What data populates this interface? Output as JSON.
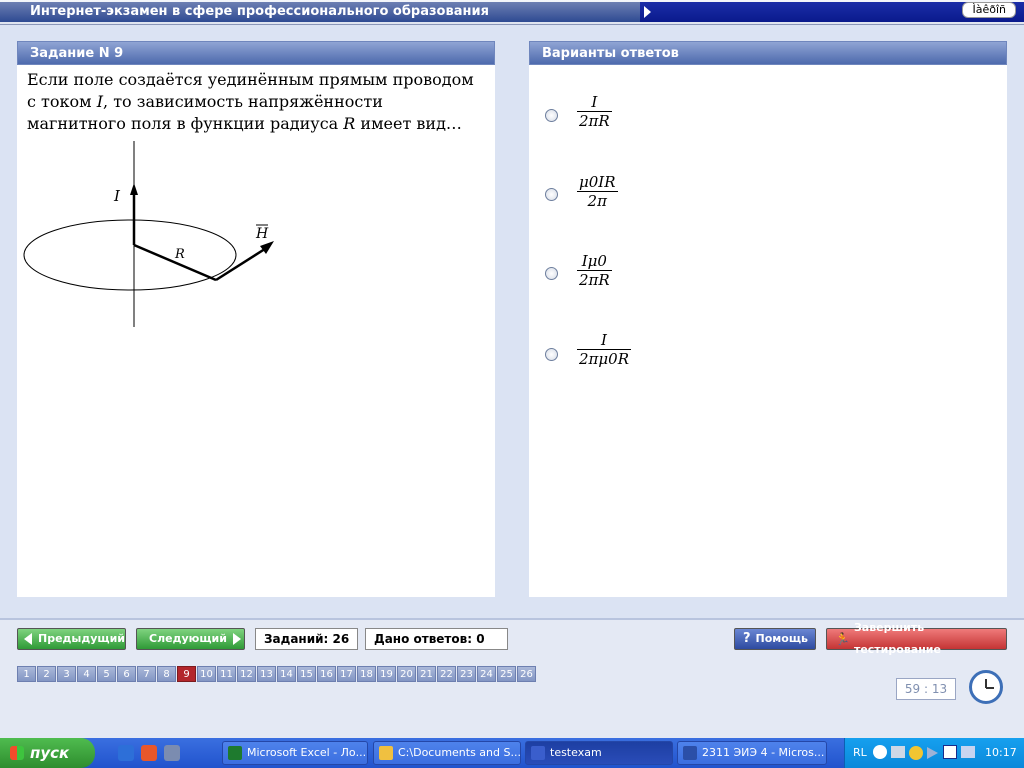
{
  "app": {
    "title": "Интернет-экзамен в сфере профессионального образования",
    "lang_label": "Ìàêðîñ"
  },
  "question": {
    "header": "Задание N 9",
    "text": "Если поле создаётся уединённым прямым проводом с током I, то зависимость напряжённости магнитного поля в функции радиуса R имеет вид…",
    "text_parts": [
      "Если поле создаётся уединённым прямым проводом с током ",
      "I",
      ", то зависимость напряжённости магнитного поля в функции радиуса ",
      "R",
      " имеет вид…"
    ],
    "figure": {
      "label_current": "I",
      "label_radius": "R",
      "label_field": "H"
    }
  },
  "answers": {
    "header": "Варианты ответов",
    "options": [
      {
        "num": "I",
        "den": "2πR"
      },
      {
        "num": "μ0IR",
        "den": "2π"
      },
      {
        "num": "Iμ0",
        "den": "2πR"
      },
      {
        "num": "I",
        "den": "2πμ0R"
      }
    ]
  },
  "controls": {
    "prev_label": "Предыдущий",
    "next_label": "Следующий",
    "tasks_count": "Заданий: 26",
    "answers_given": "Дано ответов: 0",
    "help_label": "Помощь",
    "finish_label": "Завершить тестирование",
    "question_numbers": [
      "1",
      "2",
      "3",
      "4",
      "5",
      "6",
      "7",
      "8",
      "9",
      "10",
      "11",
      "12",
      "13",
      "14",
      "15",
      "16",
      "17",
      "18",
      "19",
      "20",
      "21",
      "22",
      "23",
      "24",
      "25",
      "26"
    ],
    "current_question": "9",
    "timer": "59 : 13"
  },
  "taskbar": {
    "start_label": "пуск",
    "tasks": [
      {
        "label": "Microsoft Excel - Ло...",
        "icon": "excel-icon",
        "color": "#1e7a2e"
      },
      {
        "label": "C:\\Documents and S...",
        "icon": "folder-icon",
        "color": "#f0c040"
      },
      {
        "label": "testexam",
        "icon": "app-icon",
        "color": "#3a5ecc"
      },
      {
        "label": "2311 ЭИЭ 4 - Micros...",
        "icon": "word-icon",
        "color": "#2b4fa8"
      }
    ],
    "tray_lang": "RL",
    "clock": "10:17"
  },
  "colors": {
    "header_blue": "#4d6aad",
    "active_question": "#b3262b",
    "next_green": "#2f9a37",
    "finish_red": "#c43434"
  }
}
